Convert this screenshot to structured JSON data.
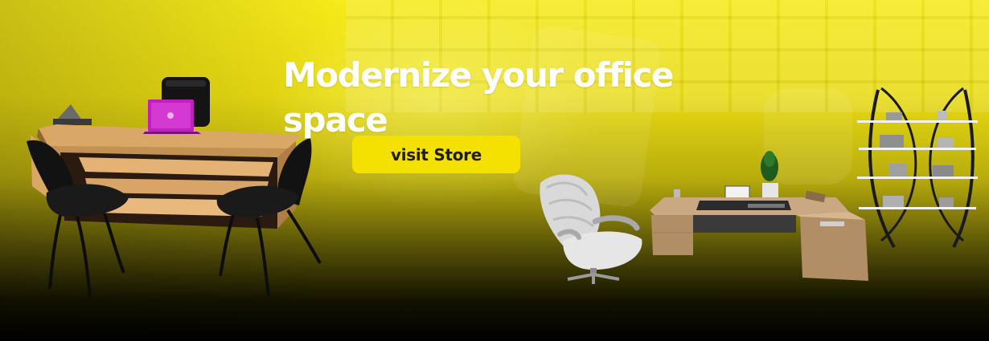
{
  "hero": {
    "headline": "Modernize your office space",
    "cta_label": "visit Store"
  },
  "colors": {
    "cta_background": "#f4e101",
    "headline_text": "#ffffff",
    "cta_text": "#1d1d1d",
    "laptop_accent": "#c21fbf"
  },
  "illustrations": [
    "office-desk-with-chairs",
    "laptop",
    "reclining-chair",
    "executive-desk",
    "bookshelf"
  ]
}
